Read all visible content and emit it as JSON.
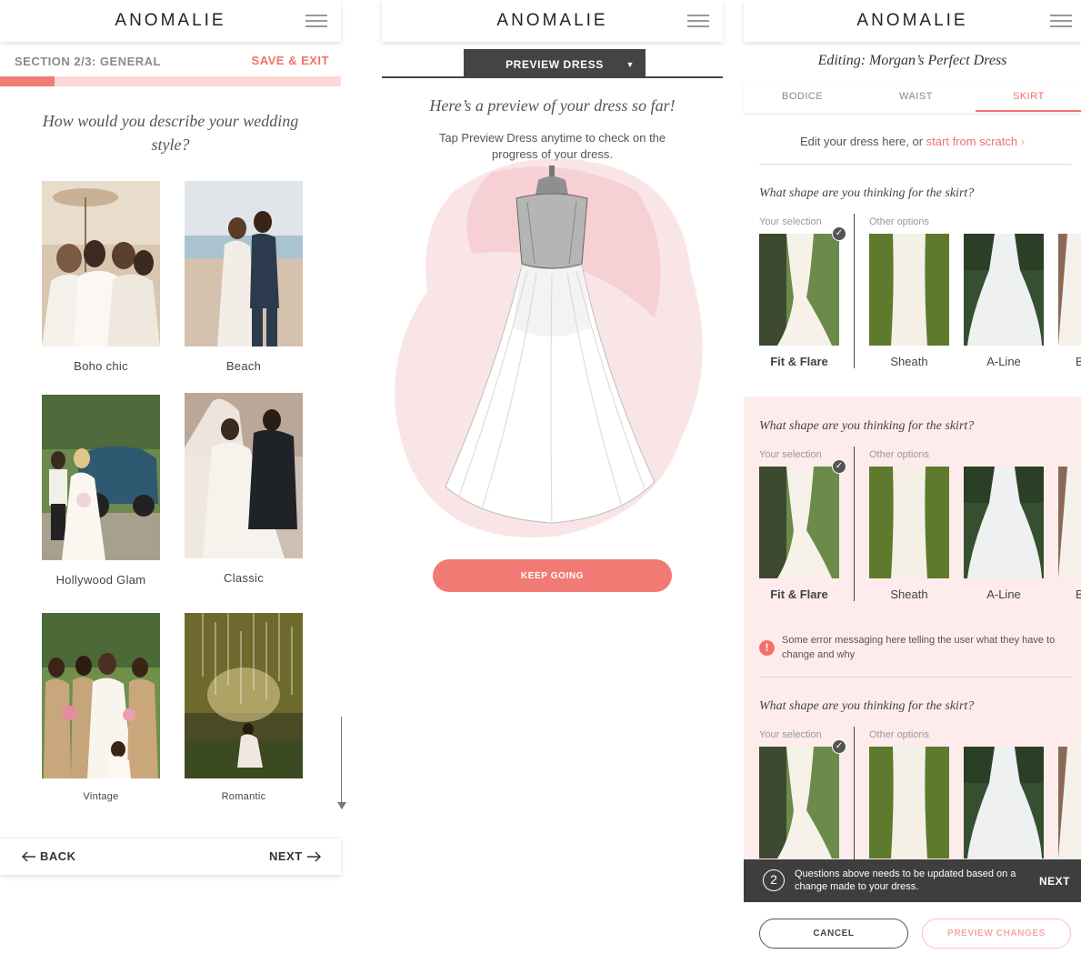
{
  "brand": {
    "logo": "ANOMALIE",
    "accent": "#f0716c"
  },
  "panel1": {
    "section_label": "SECTION 2/3: GENERAL",
    "save_exit": "SAVE & EXIT",
    "progress": 0.16,
    "question": "How would you describe your wedding style?",
    "styles": [
      {
        "label": "Boho chic"
      },
      {
        "label": "Beach"
      },
      {
        "label": "Hollywood Glam"
      },
      {
        "label": "Classic"
      },
      {
        "label": "Vintage"
      },
      {
        "label": "Romantic"
      }
    ],
    "back": "BACK",
    "next": "NEXT"
  },
  "panel2": {
    "preview_tab": "PREVIEW DRESS",
    "title": "Here’s a preview of your dress so far!",
    "subtitle": "Tap Preview Dress anytime to check on the progress of your dress.",
    "keep_going": "KEEP GOING"
  },
  "panel3": {
    "title": "Editing: Morgan’s Perfect Dress",
    "tabs": [
      "BODICE",
      "WAIST",
      "SKIRT"
    ],
    "active_tab": "SKIRT",
    "edit_hint_prefix": "Edit your dress here, or ",
    "edit_hint_link": "start from scratch",
    "question": "What shape are you thinking for the skirt?",
    "your_selection": "Your selection",
    "other_options": "Other options",
    "selected": "Fit & Flare",
    "options": [
      "Sheath",
      "A-Line",
      "Bo"
    ],
    "error": "Some error messaging here telling the user what they have to change and why",
    "update_count": "2",
    "update_text": "Questions above needs to be updated based on a change made to your dress.",
    "update_next": "NEXT",
    "cancel": "CANCEL",
    "preview_changes": "PREVIEW CHANGES"
  }
}
